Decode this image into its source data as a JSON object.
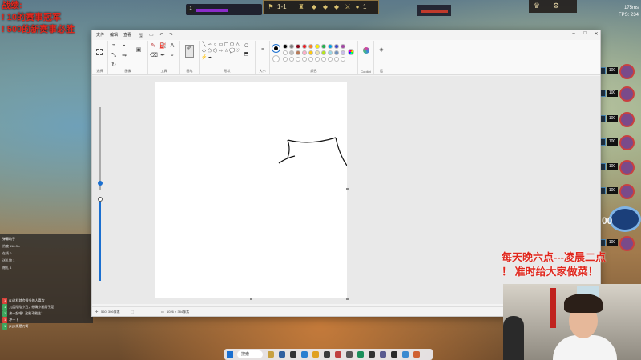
{
  "hud": {
    "player_level": "1",
    "stage": "1-1",
    "gold": "1",
    "ping": "175ms",
    "fps_label": "FPS:",
    "fps_value": "234",
    "hp_values": [
      "100",
      "100",
      "100",
      "100",
      "100",
      "100",
      "100"
    ]
  },
  "chat": {
    "rows": [
      "弹幕助手",
      "热度 118.3w",
      "在线 0",
      "送礼物 1",
      "赠礼 4"
    ],
    "messages": [
      {
        "tag": "1",
        "text": "[1]这样就会很多的人喜欢",
        "color": "#d9423a"
      },
      {
        "tag": "1",
        "text": "九层陪陪小丑，他确小鼠属于是",
        "color": "#3da55d"
      },
      {
        "tag": "1",
        "text": "来一起吧！这能不能主？",
        "color": "#3da55d"
      },
      {
        "tag": "1",
        "text": "冲一下",
        "color": "#d9423a"
      },
      {
        "tag": "1",
        "text": "[1]大概是刀哥",
        "color": "#3da55d"
      }
    ]
  },
  "paint": {
    "menu": [
      "文件",
      "编辑",
      "查看"
    ],
    "groups": {
      "select": "选择",
      "image": "图像",
      "tools": "工具",
      "brushes": "画笔",
      "shapes": "形状",
      "size": "大小",
      "colors": "颜色",
      "copilot": "Copilot",
      "layers": "层"
    },
    "palette": [
      "#000000",
      "#7f7f7f",
      "#880015",
      "#ed1c24",
      "#ff7f27",
      "#fff200",
      "#22b14c",
      "#00a2e8",
      "#3f48cc",
      "#a349a4",
      "#ffffff",
      "#c3c3c3",
      "#b97a57",
      "#ffaec9",
      "#ffc90e",
      "#efe4b0",
      "#b5e61d",
      "#99d9ea",
      "#7092be",
      "#c8bfe7"
    ],
    "status": {
      "cursor": "560, 306像素",
      "size": "1026 × 384像素"
    }
  },
  "taskbar": {
    "search": "搜索"
  },
  "promo": {
    "line1": "每天晚六点---凌晨二点",
    "line2": "！  准时给大家做菜！"
  }
}
